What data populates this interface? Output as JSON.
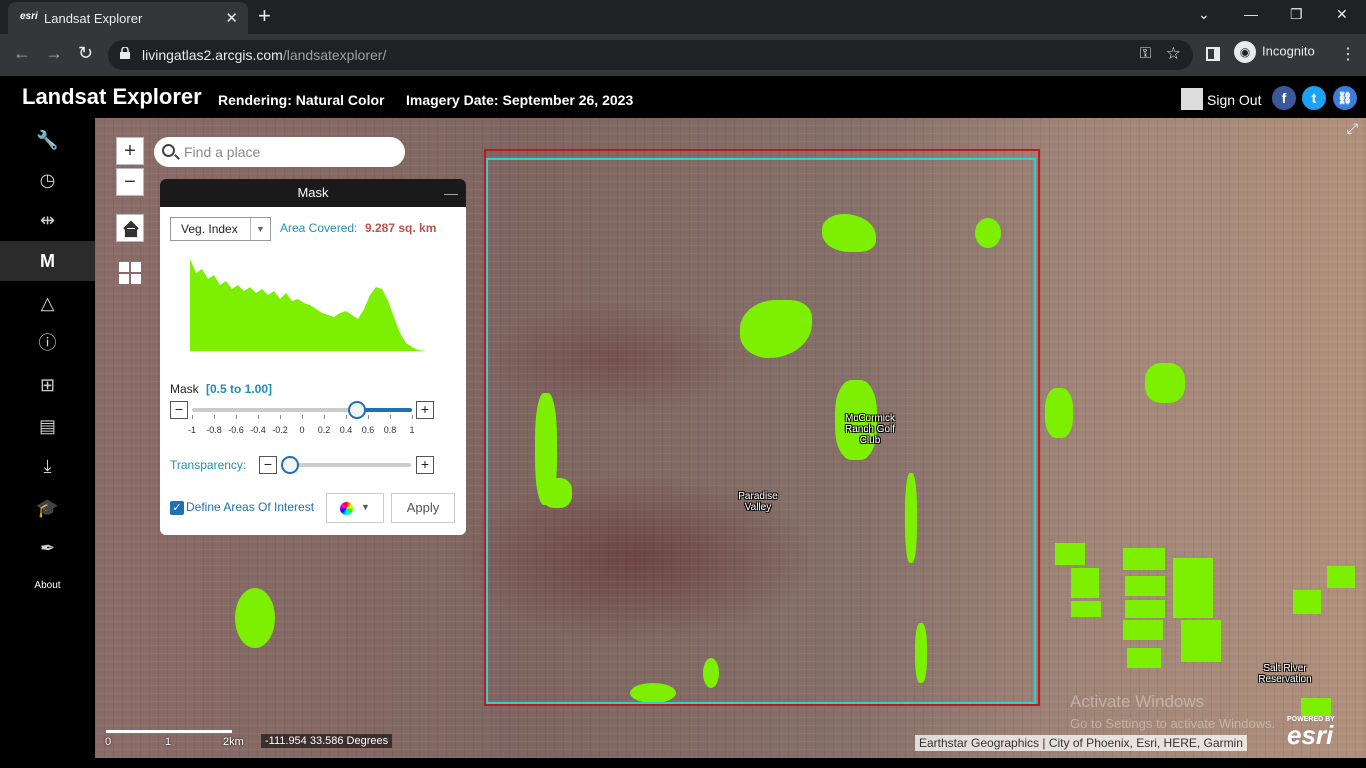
{
  "browser": {
    "tab_title": "Landsat Explorer",
    "tab_favicon": "esri",
    "url_host": "livingatlas2.arcgis.com",
    "url_path": "/landsatexplorer/",
    "incognito_label": "Incognito",
    "icons": [
      "back-icon",
      "forward-icon",
      "reload-icon",
      "lock-icon",
      "key-icon",
      "star-icon",
      "side-panel-icon",
      "incognito-icon",
      "menu-icon",
      "minimize-icon",
      "maximize-icon",
      "close-icon"
    ]
  },
  "header": {
    "title": "Landsat Explorer",
    "rendering": "Rendering: Natural Color",
    "imagery_date": "Imagery Date: September 26, 2023",
    "sign_out": "Sign Out",
    "social": [
      {
        "name": "facebook",
        "glyph": "f",
        "color": "#3b5998"
      },
      {
        "name": "twitter",
        "glyph": "t",
        "color": "#1da1f2"
      },
      {
        "name": "link",
        "glyph": "🔗",
        "color": "#3b7dd8"
      }
    ]
  },
  "sidebar": {
    "items": [
      {
        "name": "tools-icon",
        "glyph": "🔧"
      },
      {
        "name": "time-icon",
        "glyph": "◷"
      },
      {
        "name": "swipe-icon",
        "glyph": "⇹"
      },
      {
        "name": "mask-tool",
        "glyph": "M",
        "active": true
      },
      {
        "name": "change-detection-icon",
        "glyph": "△"
      },
      {
        "name": "info-icon",
        "glyph": "ⓘ"
      },
      {
        "name": "export-icon",
        "glyph": "⊞"
      },
      {
        "name": "save-icon",
        "glyph": "▤"
      },
      {
        "name": "download-icon",
        "glyph": "⤓"
      },
      {
        "name": "education-icon",
        "glyph": "🎓"
      },
      {
        "name": "feather-icon",
        "glyph": "✒"
      }
    ],
    "about": "About"
  },
  "map": {
    "search_placeholder": "Find a place",
    "zoom_in": "+",
    "zoom_out": "−",
    "labels": {
      "mccormick": "McCormick Ranch Golf Club",
      "paradise": "Paradise Valley",
      "saltriver": "Salt River Reservation"
    },
    "scale": {
      "zero": "0",
      "one": "1",
      "two": "2km"
    },
    "coordinates": "-111.954 33.586 Degrees",
    "attribution": "Earthstar Geographics | City of Phoenix, Esri, HERE, Garmin",
    "esri_powered": "POWERED BY",
    "esri_word": "esri",
    "watermark_title": "Activate Windows",
    "watermark_sub": "Go to Settings to activate Windows."
  },
  "mask_panel": {
    "title": "Mask",
    "minimize": "—",
    "index_value": "Veg. Index",
    "area_label": "Area Covered:",
    "area_value": "9.287 sq. km",
    "mask_label": "Mask",
    "mask_range": "[0.5 to 1.00]",
    "mask_min": 0.5,
    "mask_max": 1.0,
    "ticks": [
      "-1",
      "-0.8",
      "-0.6",
      "-0.4",
      "-0.2",
      "0",
      "0.2",
      "0.4",
      "0.6",
      "0.8",
      "1"
    ],
    "transparency_label": "Transparency:",
    "transparency_value": 0.0,
    "define_aoi_label": "Define Areas Of Interest",
    "define_aoi_checked": true,
    "apply_label": "Apply",
    "colors": {
      "mask": "#7cf000",
      "accent": "#1f70b4",
      "label": "#1f8fb4",
      "area_value": "#c0504d"
    }
  },
  "aoi_colors": {
    "outer": "#c4161c",
    "inner": "#27d3d3"
  }
}
